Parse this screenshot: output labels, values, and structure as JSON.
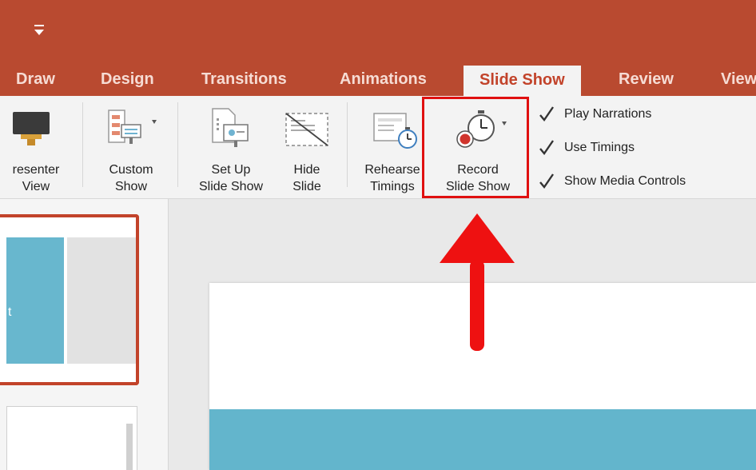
{
  "titlebar": {
    "background": "#b94a30",
    "quick_access_icon": "customize-toolbar-arrow-icon"
  },
  "tabs": [
    {
      "label": "Draw",
      "active": false
    },
    {
      "label": "Design",
      "active": false
    },
    {
      "label": "Transitions",
      "active": false
    },
    {
      "label": "Animations",
      "active": false
    },
    {
      "label": "Slide Show",
      "active": true
    },
    {
      "label": "Review",
      "active": false
    },
    {
      "label": "View",
      "active": false
    }
  ],
  "ribbon": {
    "presenter_view": {
      "line1": "resenter",
      "line2": "View",
      "icon": "presenter-view-icon"
    },
    "custom_show": {
      "line1": "Custom",
      "line2": "Show",
      "icon": "custom-show-icon"
    },
    "set_up": {
      "line1": "Set Up",
      "line2": "Slide Show",
      "icon": "set-up-slide-show-icon"
    },
    "hide_slide": {
      "line1": "Hide",
      "line2": "Slide",
      "icon": "hide-slide-icon"
    },
    "rehearse": {
      "line1": "Rehearse",
      "line2": "Timings",
      "icon": "rehearse-timings-icon"
    },
    "record": {
      "line1": "Record",
      "line2": "Slide Show",
      "icon": "record-slide-show-icon"
    },
    "checkboxes": [
      {
        "label": "Play Narrations",
        "checked": true
      },
      {
        "label": "Use Timings",
        "checked": true
      },
      {
        "label": "Show Media Controls",
        "checked": true
      }
    ]
  },
  "thumbnail": {
    "text": "t",
    "accent": "#c2432a",
    "slide_blue": "#68b7ce"
  },
  "annotation": {
    "color": "#e01010",
    "icon": "red-up-arrow-icon"
  }
}
